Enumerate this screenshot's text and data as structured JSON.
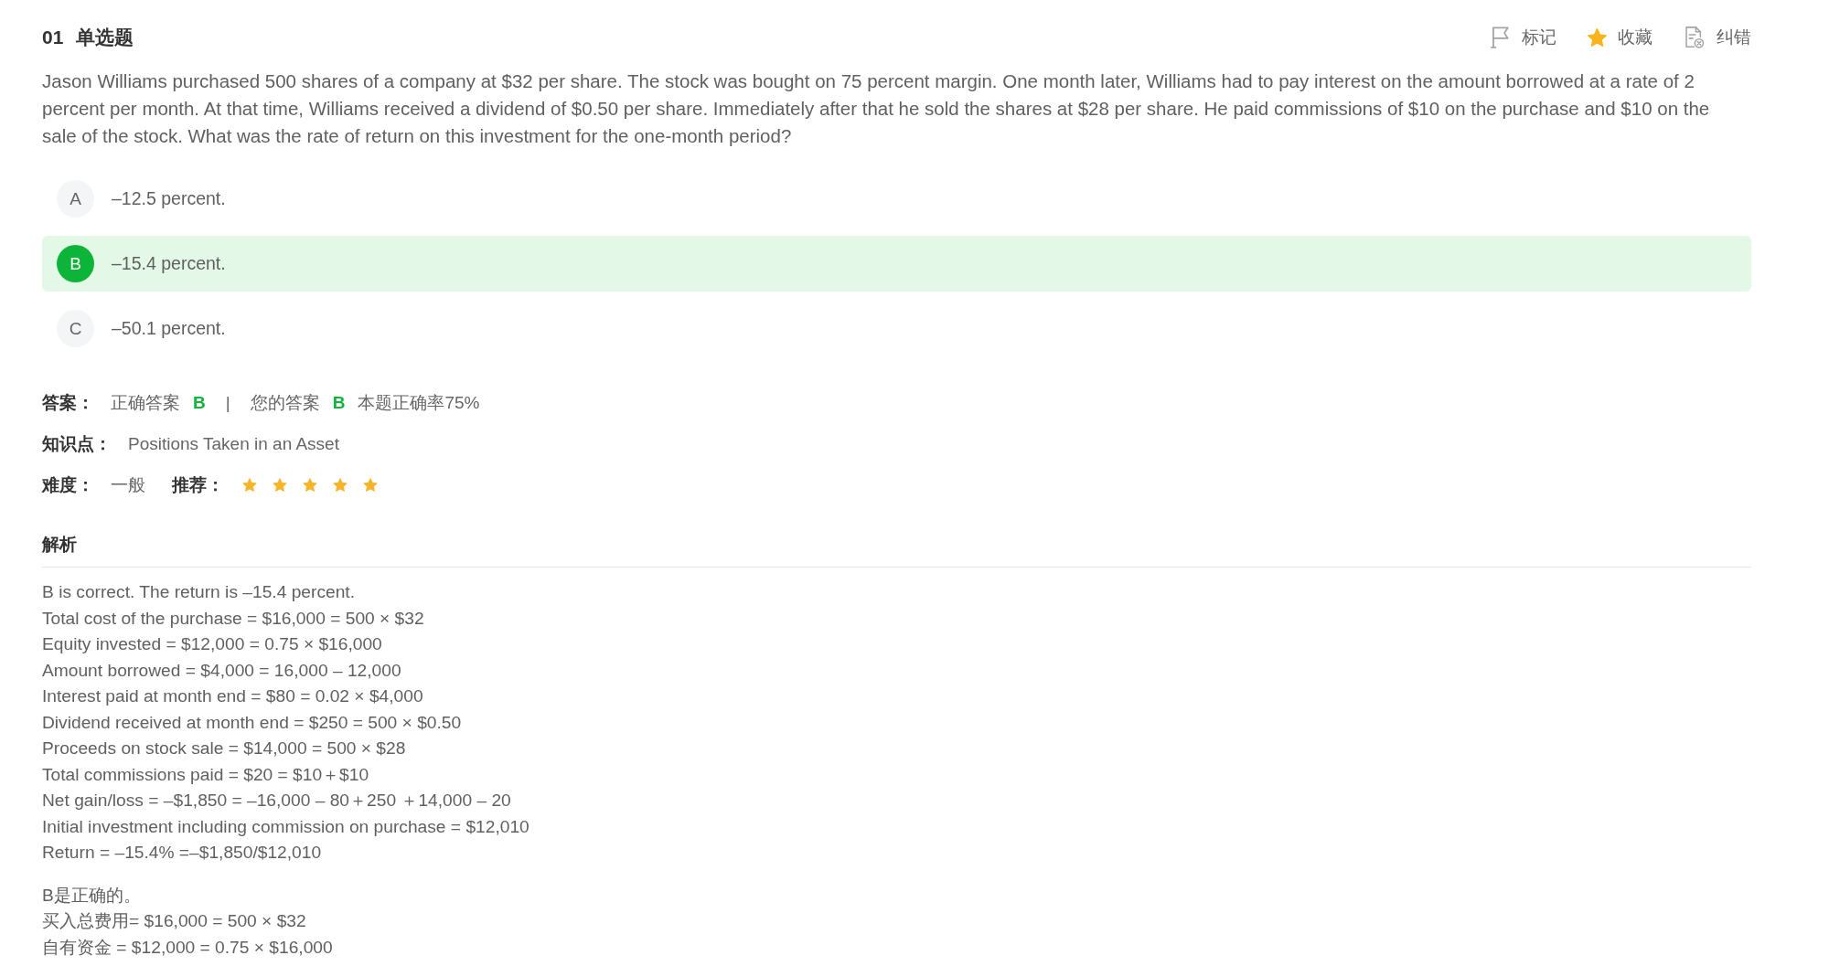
{
  "question": {
    "number": "01",
    "type": "单选题",
    "text": "Jason Williams purchased 500 shares of a company at $32 per share. The stock was bought on 75 percent margin. One month later, Williams had to pay interest on the amount borrowed at a rate of 2 percent per month. At that time, Williams received a dividend of $0.50 per share. Immediately after that he sold the shares at $28 per share. He paid commissions of $10 on the purchase and $10 on the sale of the stock. What was the rate of return on this investment for the one-month period?"
  },
  "toolbar": [
    {
      "kind": "flag",
      "label": "标记",
      "on": false
    },
    {
      "kind": "star",
      "label": "收藏",
      "on": true
    },
    {
      "kind": "report",
      "label": "纠错",
      "on": false
    }
  ],
  "options": [
    {
      "letter": "A",
      "text": "–12.5 percent.",
      "selected": false
    },
    {
      "letter": "B",
      "text": "–15.4 percent.",
      "selected": true
    },
    {
      "letter": "C",
      "text": "–50.1 percent.",
      "selected": false
    }
  ],
  "answer": {
    "label": "答案：",
    "correct_label": "正确答案",
    "correct": "B",
    "separator": "|",
    "yours_label": "您的答案",
    "yours": "B",
    "rate": "本题正确率75%"
  },
  "knowledge": {
    "label": "知识点：",
    "value": "Positions Taken in an Asset"
  },
  "difficulty": {
    "label": "难度：",
    "value": "一般"
  },
  "recommend": {
    "label": "推荐：",
    "stars": 5
  },
  "explanation": {
    "title": "解析",
    "paragraphs": [
      [
        "B is correct. The return is –15.4 percent.",
        "Total cost of the purchase = $16,000 = 500 × $32",
        "Equity invested = $12,000 = 0.75 × $16,000",
        "Amount borrowed = $4,000 = 16,000 – 12,000",
        "Interest paid at month end = $80 = 0.02 × $4,000",
        "Dividend received at month end = $250 = 500 × $0.50",
        "Proceeds on stock sale = $14,000 = 500 × $28",
        "Total commissions paid = $20 = $10＋$10",
        "Net gain/loss = –$1,850 = –16,000 – 80＋250 ＋14,000 – 20",
        "Initial investment including commission on purchase = $12,010",
        "Return = –15.4% =–$1,850/$12,010"
      ],
      [
        "B是正确的。",
        "买入总费用= $16,000 = 500 × $32",
        "自有资金 = $12,000 = 0.75 × $16,000"
      ]
    ]
  }
}
